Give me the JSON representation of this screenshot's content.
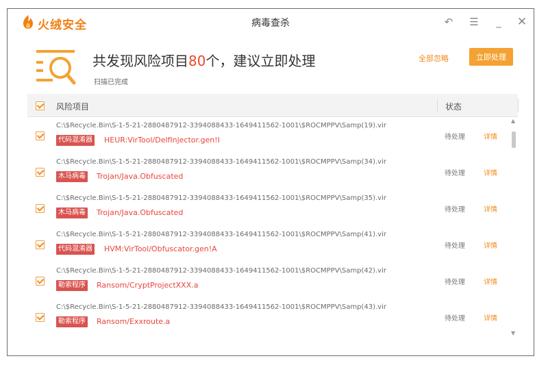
{
  "app": {
    "name": "火绒安全",
    "window_title": "病毒查杀"
  },
  "titlebar_icons": [
    "undo-icon",
    "menu-icon",
    "minimize-icon",
    "close-icon"
  ],
  "header": {
    "title_prefix": "共发现风险项目",
    "count": "80",
    "title_suffix": "个，建议立即处理",
    "subtitle": "扫描已完成",
    "ignore_all": "全部忽略",
    "process_now": "立即处理"
  },
  "table": {
    "col_item": "风险项目",
    "col_status": "状态",
    "rows": [
      {
        "path": "C:\\$Recycle.Bin\\S-1-5-21-2880487912-3394088433-1649411562-1001\\$ROCMPPV\\Samp(19).vir",
        "tag": "代码混淆器",
        "virus": "HEUR:VirTool/DelfInjector.gen!I",
        "status": "待处理",
        "detail": "详情"
      },
      {
        "path": "C:\\$Recycle.Bin\\S-1-5-21-2880487912-3394088433-1649411562-1001\\$ROCMPPV\\Samp(34).vir",
        "tag": "木马病毒",
        "virus": "Trojan/Java.Obfuscated",
        "status": "待处理",
        "detail": "详情"
      },
      {
        "path": "C:\\$Recycle.Bin\\S-1-5-21-2880487912-3394088433-1649411562-1001\\$ROCMPPV\\Samp(35).vir",
        "tag": "木马病毒",
        "virus": "Trojan/Java.Obfuscated",
        "status": "待处理",
        "detail": "详情"
      },
      {
        "path": "C:\\$Recycle.Bin\\S-1-5-21-2880487912-3394088433-1649411562-1001\\$ROCMPPV\\Samp(41).vir",
        "tag": "代码混淆器",
        "virus": "HVM:VirTool/Obfuscator.gen!A",
        "status": "待处理",
        "detail": "详情"
      },
      {
        "path": "C:\\$Recycle.Bin\\S-1-5-21-2880487912-3394088433-1649411562-1001\\$ROCMPPV\\Samp(42).vir",
        "tag": "勒索程序",
        "virus": "Ransom/CryptProjectXXX.a",
        "status": "待处理",
        "detail": "详情"
      },
      {
        "path": "C:\\$Recycle.Bin\\S-1-5-21-2880487912-3394088433-1649411562-1001\\$ROCMPPV\\Samp(43).vir",
        "tag": "勒索程序",
        "virus": "Ransom/Exxroute.a",
        "status": "待处理",
        "detail": "详情"
      }
    ]
  },
  "colors": {
    "brand": "#f27f14",
    "accent_button": "#f4a233",
    "threat_tag": "#d9534f",
    "threat_text": "#e8453c",
    "count": "#f0462b"
  }
}
